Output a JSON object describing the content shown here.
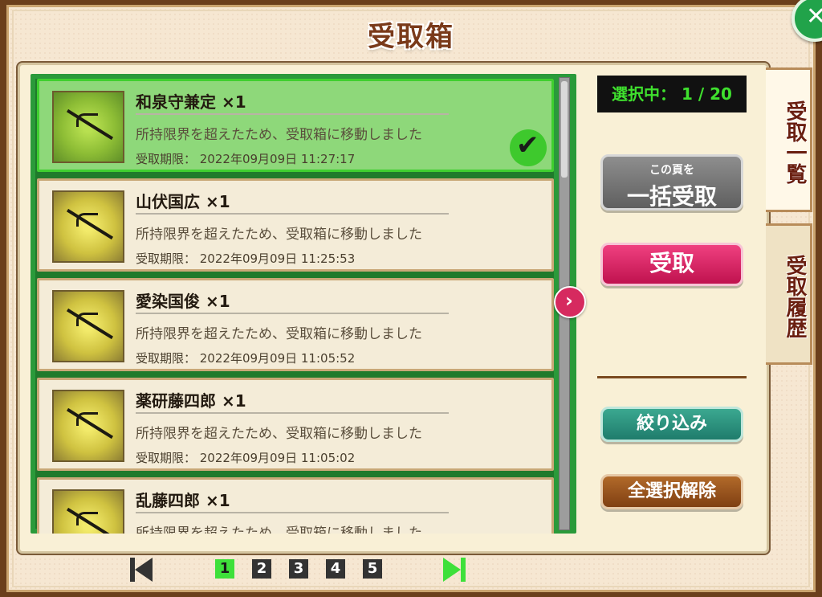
{
  "header": {
    "title": "受取箱"
  },
  "counter": {
    "text": "選択中： 1 / 20"
  },
  "items": [
    {
      "name": "和泉守兼定 ×1",
      "message": "所持限界を超えたため、受取箱に移動しました",
      "limit": "受取期限： 2022年09月09日 11:27:17",
      "selected": true
    },
    {
      "name": "山伏国広 ×1",
      "message": "所持限界を超えたため、受取箱に移動しました",
      "limit": "受取期限： 2022年09月09日 11:25:53",
      "selected": false
    },
    {
      "name": "愛染国俊 ×1",
      "message": "所持限界を超えたため、受取箱に移動しました",
      "limit": "受取期限： 2022年09月09日 11:05:52",
      "selected": false
    },
    {
      "name": "薬研藤四郎 ×1",
      "message": "所持限界を超えたため、受取箱に移動しました",
      "limit": "受取期限： 2022年09月09日 11:05:02",
      "selected": false
    },
    {
      "name": "乱藤四郎 ×1",
      "message": "所持限界を超えたため、受取箱に移動しました",
      "limit": "",
      "selected": false
    }
  ],
  "buttons": {
    "bulk_sub": "この頁を",
    "bulk_main": "一括受取",
    "receive": "受取",
    "filter": "絞り込み",
    "deselect": "全選択解除"
  },
  "tabs": {
    "list": "受取一覧",
    "history": "受取履歴"
  },
  "pagination": {
    "pages": [
      "1",
      "2",
      "3",
      "4",
      "5"
    ],
    "current": "1"
  },
  "colors": {
    "accent_green": "#3ee03a",
    "receive_pink": "#d62a5f"
  }
}
